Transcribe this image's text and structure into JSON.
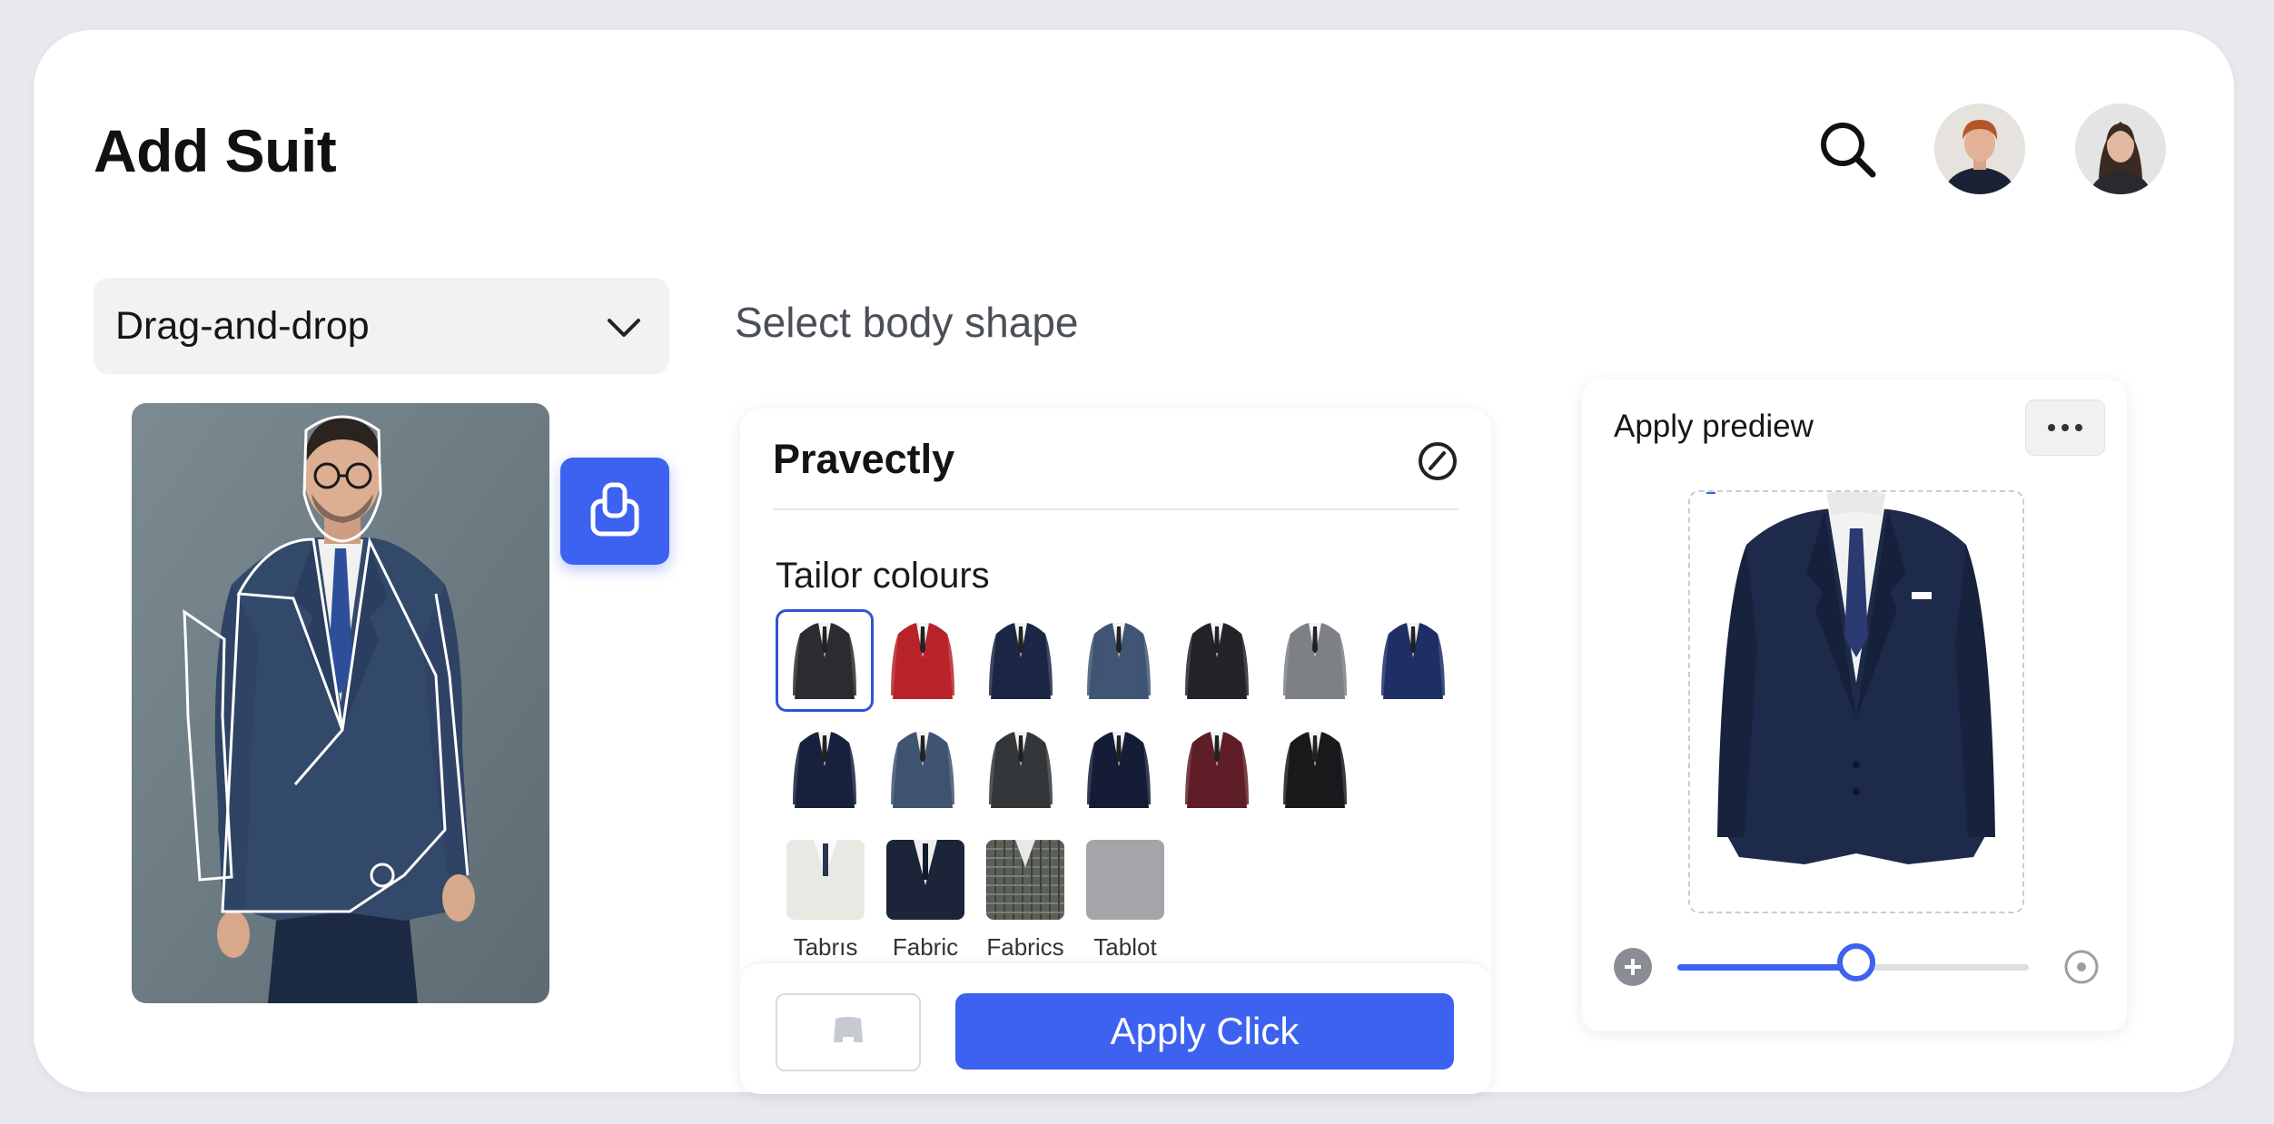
{
  "header": {
    "title": "Add Suit",
    "search_icon": "search-icon",
    "avatars": [
      "male-user-avatar",
      "female-user-avatar"
    ]
  },
  "input_mode": {
    "selected": "Drag-and-drop",
    "icon": "chevron-down-icon"
  },
  "upload": {
    "icon": "clipboard-paste-icon"
  },
  "body_shape": {
    "label": "Select body shape"
  },
  "options_panel": {
    "title": "Pravectly",
    "edit_icon": "slash-circle-icon",
    "colours_label": "Tailor colours",
    "colours": [
      {
        "name": "charcoal",
        "hex": "#2b2c30",
        "selected": true
      },
      {
        "name": "red",
        "hex": "#b8232a"
      },
      {
        "name": "navy",
        "hex": "#1b2744"
      },
      {
        "name": "slate-blue",
        "hex": "#3f5573"
      },
      {
        "name": "black",
        "hex": "#23242a"
      },
      {
        "name": "grey",
        "hex": "#7d8084"
      },
      {
        "name": "royal-navy",
        "hex": "#1e2f66"
      },
      {
        "name": "midnight",
        "hex": "#17213d"
      },
      {
        "name": "steel-blue",
        "hex": "#3f5470"
      },
      {
        "name": "dark-grey",
        "hex": "#34373a"
      },
      {
        "name": "deep-navy",
        "hex": "#141c36"
      },
      {
        "name": "burgundy",
        "hex": "#5f1e27"
      },
      {
        "name": "jet-black",
        "hex": "#1a1a1d"
      }
    ],
    "fabrics": [
      {
        "label": "Tabrıs",
        "type": "linen"
      },
      {
        "label": "Fabric",
        "type": "dark"
      },
      {
        "label": "Fabrics",
        "type": "plaid"
      },
      {
        "label": "Tablot",
        "type": "grey"
      }
    ],
    "apply_label": "Apply Click",
    "secondary_icon": "jacket-outline-icon"
  },
  "preview": {
    "title": "Apply prediew",
    "more_icon": "more-horizontal-icon",
    "jacket_colour": "#1d2a4a",
    "zoom_level": 0.51
  },
  "colors": {
    "accent": "#3d62f0",
    "background": "#e7e9ee"
  }
}
